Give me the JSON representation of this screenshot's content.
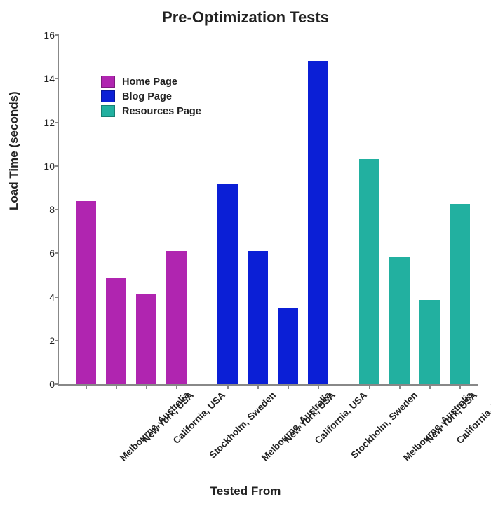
{
  "chart_data": {
    "type": "bar",
    "title": "Pre-Optimization Tests",
    "xlabel": "Tested From",
    "ylabel": "Load Time (seconds)",
    "ylim": [
      0,
      16
    ],
    "yticks": [
      0,
      2,
      4,
      6,
      8,
      10,
      12,
      14,
      16
    ],
    "categories": [
      "Melbourne, Australia",
      "New York, USA",
      "California, USA",
      "Stockholm, Sweden"
    ],
    "series": [
      {
        "name": "Home Page",
        "color": "#b025b0",
        "values": [
          8.4,
          4.9,
          4.1,
          6.1
        ]
      },
      {
        "name": "Blog Page",
        "color": "#0b1fd6",
        "values": [
          9.2,
          6.1,
          3.5,
          14.8
        ]
      },
      {
        "name": "Resources Page",
        "color": "#22b0a0",
        "values": [
          10.3,
          5.85,
          3.85,
          8.25
        ]
      }
    ],
    "legend_position": "top-left"
  }
}
